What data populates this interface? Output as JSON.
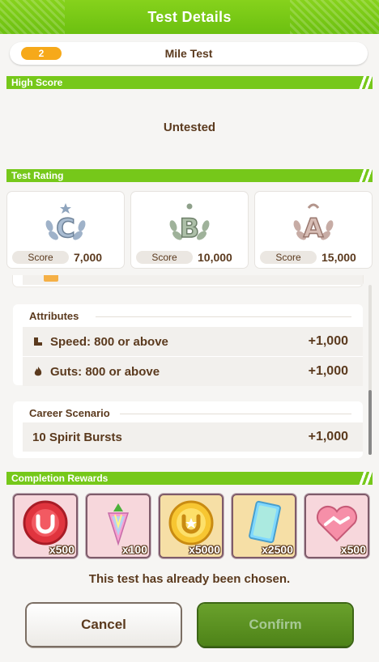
{
  "header": {
    "title": "Test Details"
  },
  "test": {
    "number": "2",
    "name": "Mile Test"
  },
  "high_score": {
    "section_label": "High Score",
    "value": "Untested"
  },
  "test_rating": {
    "section_label": "Test Rating",
    "ranks": [
      {
        "grade": "C",
        "score_label": "Score",
        "score": "7,000"
      },
      {
        "grade": "B",
        "score_label": "Score",
        "score": "10,000"
      },
      {
        "grade": "A",
        "score_label": "Score",
        "score": "15,000"
      }
    ]
  },
  "criteria": {
    "attributes": {
      "title": "Attributes",
      "rows": [
        {
          "icon": "boot-icon",
          "label": "Speed: 800 or above",
          "bonus": "+1,000"
        },
        {
          "icon": "flame-icon",
          "label": "Guts: 800 or above",
          "bonus": "+1,000"
        }
      ]
    },
    "career_scenario": {
      "title": "Career Scenario",
      "rows": [
        {
          "label": "10 Spirit Bursts",
          "bonus": "+1,000"
        }
      ]
    }
  },
  "completion_rewards": {
    "section_label": "Completion Rewards",
    "items": [
      {
        "icon": "horseshoe-badge-icon",
        "qty": "x500"
      },
      {
        "icon": "carrot-icon",
        "qty": "x100"
      },
      {
        "icon": "gold-coin-icon",
        "qty": "x5000"
      },
      {
        "icon": "crystal-card-icon",
        "qty": "x2500"
      },
      {
        "icon": "handshake-icon",
        "qty": "x500"
      }
    ]
  },
  "message": "This test has already been chosen.",
  "buttons": {
    "cancel": "Cancel",
    "confirm": "Confirm"
  },
  "colors": {
    "accent_green": "#76c81a",
    "brown_text": "#5b3a1e",
    "score_gold": "#f6a91a"
  }
}
